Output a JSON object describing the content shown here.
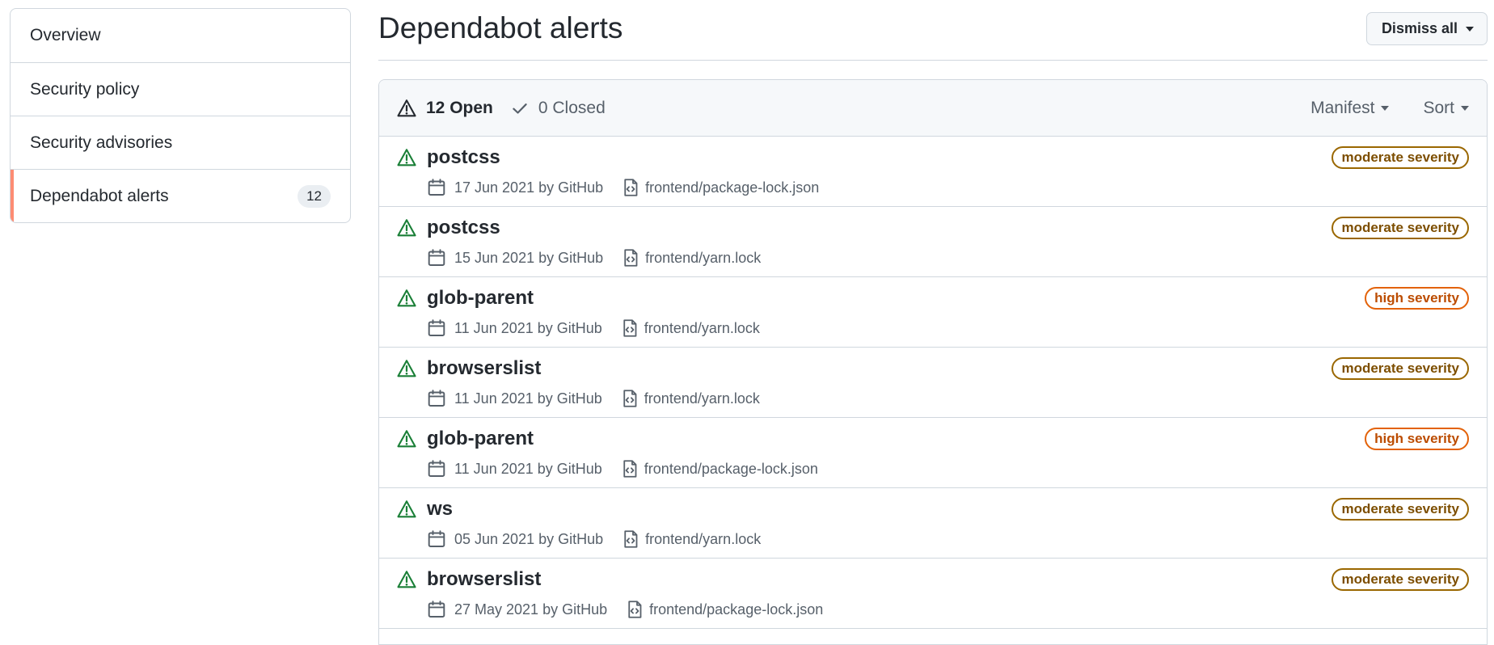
{
  "sidebar": {
    "items": [
      {
        "label": "Overview"
      },
      {
        "label": "Security policy"
      },
      {
        "label": "Security advisories"
      },
      {
        "label": "Dependabot alerts",
        "count": "12"
      }
    ]
  },
  "header": {
    "title": "Dependabot alerts",
    "dismiss_label": "Dismiss all"
  },
  "filters": {
    "open_label": "12 Open",
    "closed_label": "0 Closed",
    "manifest_label": "Manifest",
    "sort_label": "Sort"
  },
  "colors": {
    "accent": "#fd8c73",
    "alert_icon": "#1a7f37",
    "moderate": "#9a6700",
    "high": "#e36209"
  },
  "alerts": [
    {
      "package": "postcss",
      "date": "17 Jun 2021 by GitHub",
      "file": "frontend/package-lock.json",
      "severity": "moderate severity"
    },
    {
      "package": "postcss",
      "date": "15 Jun 2021 by GitHub",
      "file": "frontend/yarn.lock",
      "severity": "moderate severity"
    },
    {
      "package": "glob-parent",
      "date": "11 Jun 2021 by GitHub",
      "file": "frontend/yarn.lock",
      "severity": "high severity"
    },
    {
      "package": "browserslist",
      "date": "11 Jun 2021 by GitHub",
      "file": "frontend/yarn.lock",
      "severity": "moderate severity"
    },
    {
      "package": "glob-parent",
      "date": "11 Jun 2021 by GitHub",
      "file": "frontend/package-lock.json",
      "severity": "high severity"
    },
    {
      "package": "ws",
      "date": "05 Jun 2021 by GitHub",
      "file": "frontend/yarn.lock",
      "severity": "moderate severity"
    },
    {
      "package": "browserslist",
      "date": "27 May 2021 by GitHub",
      "file": "frontend/package-lock.json",
      "severity": "moderate severity"
    }
  ]
}
